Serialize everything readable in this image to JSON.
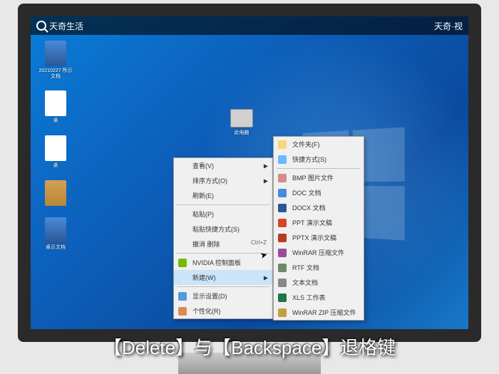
{
  "top_bar": {
    "left_brand": "天奇生活",
    "right_brand": "天奇·视"
  },
  "desktop": {
    "icons": [
      {
        "label": "20210227\n所示文档"
      },
      {
        "label": "桌"
      },
      {
        "label": "桌"
      },
      {
        "label": ""
      },
      {
        "label": "桌示文档"
      }
    ],
    "center_icon_label": "此电脑"
  },
  "context_menu_main": {
    "items": [
      {
        "label": "查看(V)",
        "arrow": true
      },
      {
        "label": "排序方式(O)",
        "arrow": true
      },
      {
        "label": "刷新(E)"
      },
      {
        "sep": true
      },
      {
        "label": "粘贴(P)"
      },
      {
        "label": "粘贴快捷方式(S)"
      },
      {
        "label": "撤消 删除",
        "shortcut": "Ctrl+Z"
      },
      {
        "sep": true
      },
      {
        "label": "NVIDIA 控制面板",
        "icon": "nvidia"
      },
      {
        "label": "新建(W)",
        "arrow": true,
        "hover": true
      },
      {
        "sep": true
      },
      {
        "label": "显示设置(D)",
        "icon": "display"
      },
      {
        "label": "个性化(R)",
        "icon": "personalize"
      }
    ]
  },
  "context_menu_new": {
    "items": [
      {
        "label": "文件夹(F)",
        "icon": "folder"
      },
      {
        "label": "快捷方式(S)",
        "icon": "shortcut"
      },
      {
        "sep": true
      },
      {
        "label": "BMP 图片文件",
        "icon": "bmp"
      },
      {
        "label": "DOC 文档",
        "icon": "doc"
      },
      {
        "label": "DOCX 文档",
        "icon": "docx"
      },
      {
        "label": "PPT 演示文稿",
        "icon": "ppt"
      },
      {
        "label": "PPTX 演示文稿",
        "icon": "pptx"
      },
      {
        "label": "WinRAR 压缩文件",
        "icon": "rar"
      },
      {
        "label": "RTF 文档",
        "icon": "rtf"
      },
      {
        "label": "文本文档",
        "icon": "txt"
      },
      {
        "label": "XLS 工作表",
        "icon": "xls"
      },
      {
        "label": "WinRAR ZIP 压缩文件",
        "icon": "zip"
      }
    ]
  },
  "subtitle": "【Delete】与【Backspace】退格键"
}
